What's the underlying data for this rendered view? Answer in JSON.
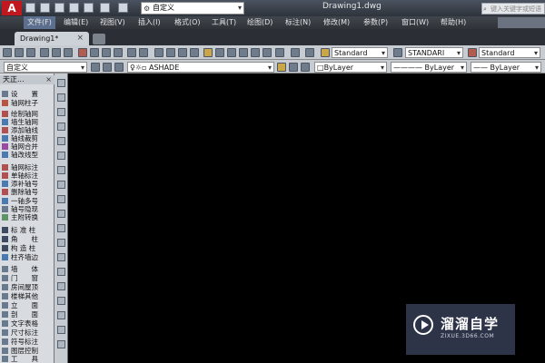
{
  "title_bar": {
    "app_logo": "A",
    "workspace": "自定义",
    "document_title": "Drawing1.dwg",
    "search_placeholder": "键入关键字或短语"
  },
  "menu": {
    "items": [
      "文件(F)",
      "编辑(E)",
      "视图(V)",
      "插入(I)",
      "格式(O)",
      "工具(T)",
      "绘图(D)",
      "标注(N)",
      "修改(M)",
      "参数(P)",
      "窗口(W)",
      "帮助(H)"
    ],
    "active_index": 0
  },
  "tabs": {
    "active_label": "Drawing1*",
    "close_glyph": "×"
  },
  "toolbar": {
    "text_style": "Standard",
    "dim_style": "STANDARI",
    "table_style": "Standard",
    "workspace_combo": "自定义",
    "layer": "ASHADE",
    "color": "ByLayer",
    "linetype": "ByLayer",
    "lineweight": "ByLayer"
  },
  "panel": {
    "title": "天正...",
    "close_glyph": "×",
    "items": [
      "设　　置",
      "轴网柱子",
      "绘制轴网",
      "墙生轴网",
      "添加轴线",
      "轴线裁剪",
      "轴网合并",
      "轴改线型",
      "轴网标注",
      "单轴标注",
      "添补轴号",
      "删除轴号",
      "一轴多号",
      "轴号隐现",
      "主附转换",
      "标 准 柱",
      "角　　柱",
      "构 造 柱",
      "柱齐墙边",
      "墙　　体",
      "门　　窗",
      "房间屋顶",
      "楼梯其他",
      "立　　面",
      "剖　　面",
      "文字表格",
      "尺寸标注",
      "符号标注",
      "图层控制",
      "工　　具"
    ]
  },
  "watermark": {
    "brand": "溜溜自学",
    "url": "ZIXUE.3D66.COM"
  }
}
